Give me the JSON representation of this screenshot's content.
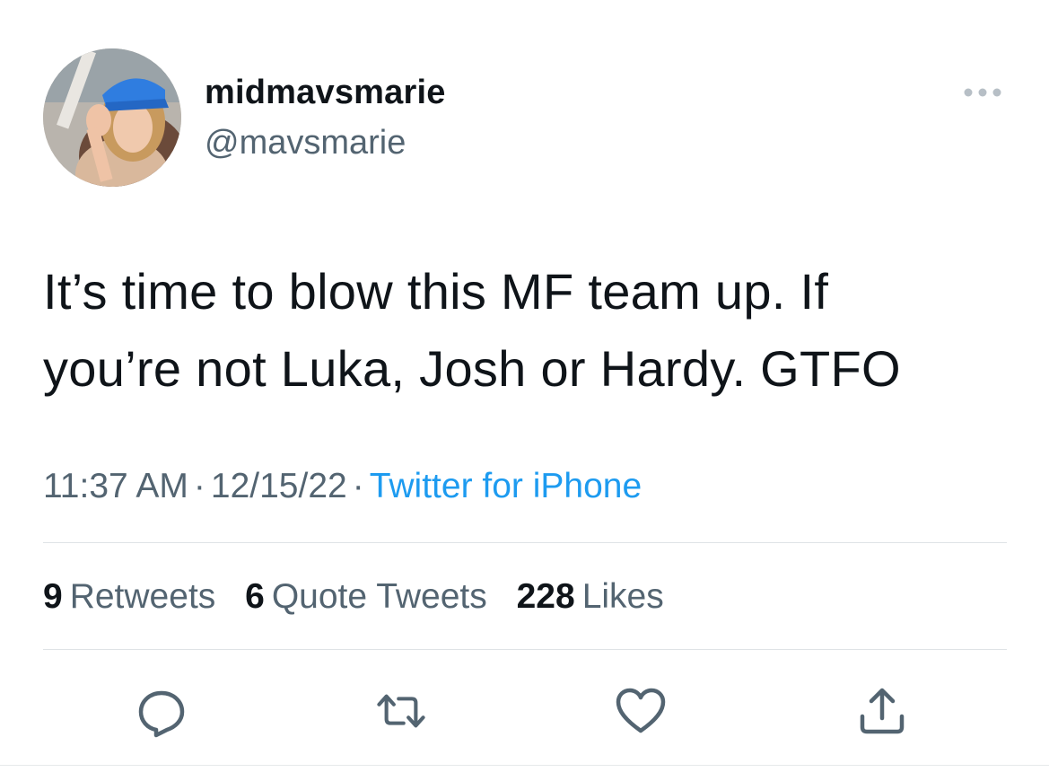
{
  "user": {
    "display_name": "midmavsmarie",
    "handle": "@mavsmarie",
    "avatar_icon": "profile-photo"
  },
  "tweet": {
    "text_lines": [
      "It’s time to blow this MF team up. If",
      "you’re not Luka, Josh or Hardy. GTFO"
    ],
    "time": "11:37 AM",
    "date": "12/15/22",
    "separator": "·",
    "source": "Twitter for iPhone"
  },
  "stats": {
    "retweets_count": "9",
    "retweets_label": "Retweets",
    "quotes_count": "6",
    "quotes_label": "Quote Tweets",
    "likes_count": "228",
    "likes_label": "Likes"
  },
  "actions": [
    "reply-icon",
    "retweet-icon",
    "like-icon",
    "share-icon"
  ],
  "colors": {
    "text": "#0f1419",
    "secondary": "#536471",
    "link": "#1d9bf0",
    "divider": "#dfe3e6"
  }
}
